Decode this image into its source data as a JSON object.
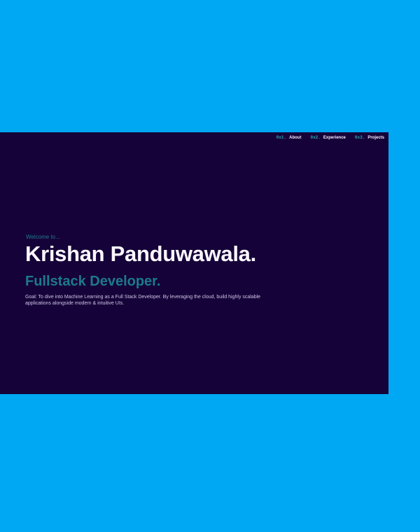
{
  "nav": {
    "items": [
      {
        "number": "0x1.",
        "label": "About"
      },
      {
        "number": "0x2.",
        "label": "Experience"
      },
      {
        "number": "0x3.",
        "label": "Projects"
      }
    ]
  },
  "hero": {
    "welcome": "Welcome to...",
    "name": "Krishan Panduwawala.",
    "role": "Fullstack Developer.",
    "description": "Goal: To dive into Machine Learning as a Full Stack Developer. By leveraging the cloud, build highly scalable applications alongside modern & intuitive UIs."
  },
  "colors": {
    "page_background": "#00a8f3",
    "panel_background": "#150238",
    "accent": "#1c7a8a",
    "text_light": "#faf7ff"
  }
}
